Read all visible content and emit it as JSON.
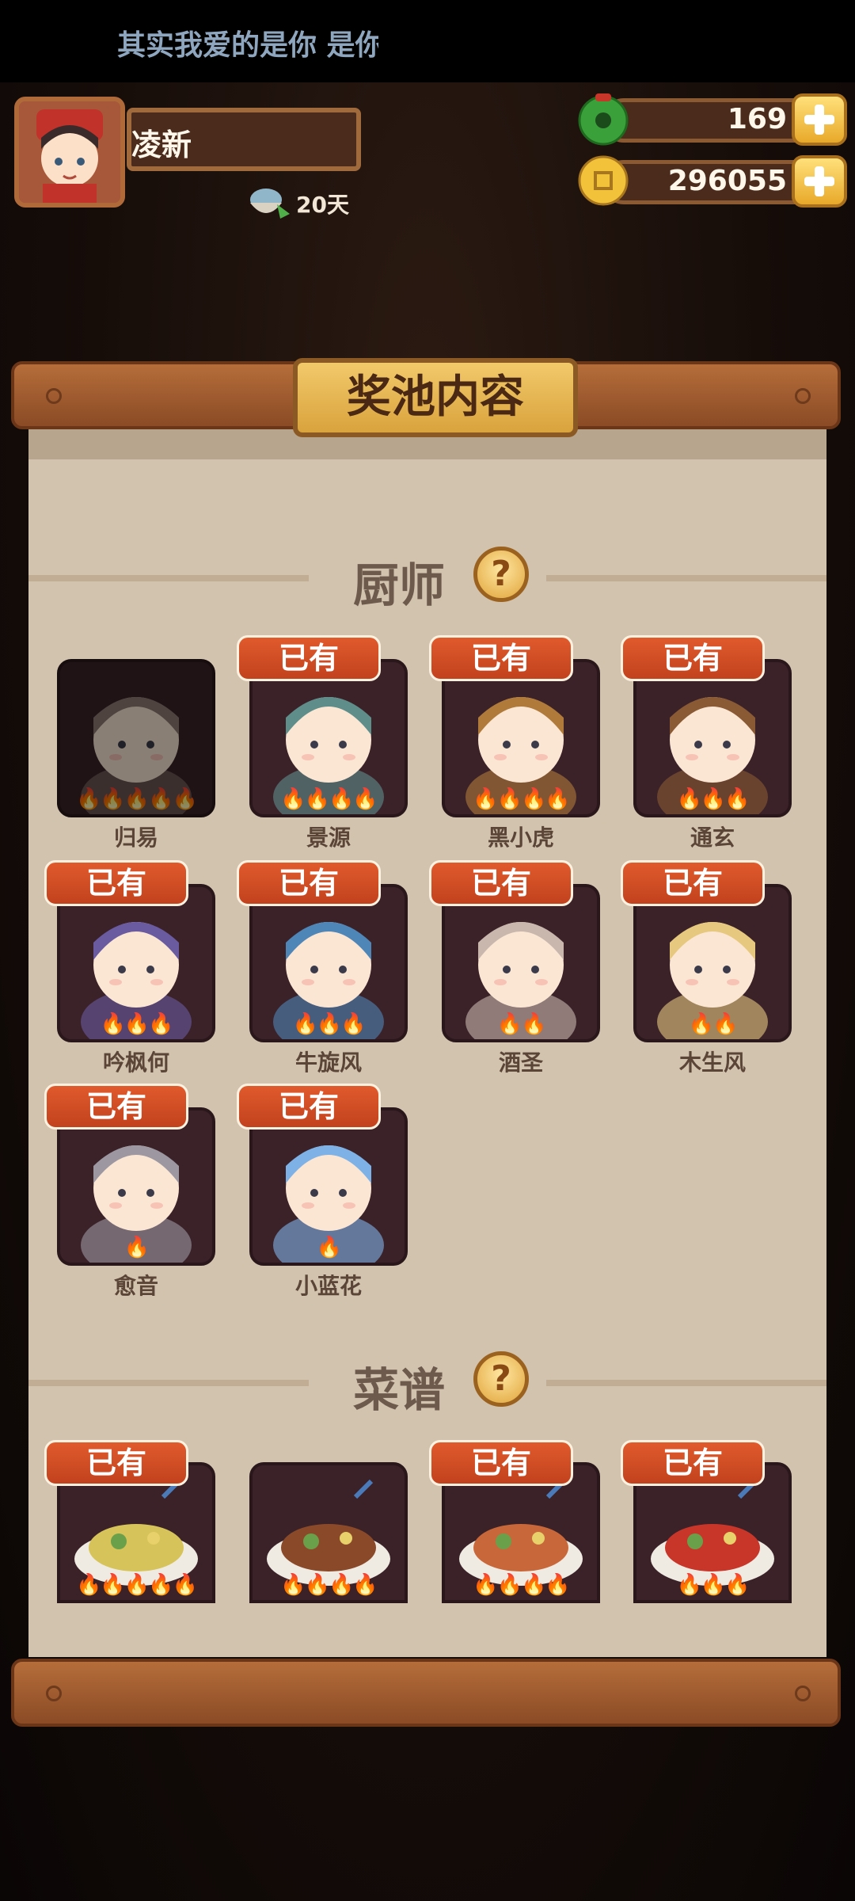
{
  "status_bar": {
    "lyric": "其实我爱的是你 是你"
  },
  "player": {
    "name": "凌新",
    "days": "20天"
  },
  "currency": {
    "jade": "169",
    "coins": "296055"
  },
  "panel": {
    "title": "奖池内容"
  },
  "chefs": {
    "title": "厨师",
    "help": "?",
    "owned_label": "已有",
    "items": [
      {
        "name": "归易",
        "owned": false,
        "stars": 5,
        "color": "#8d7a72"
      },
      {
        "name": "景源",
        "owned": true,
        "stars": 4,
        "color": "#5f8e8a"
      },
      {
        "name": "黑小虎",
        "owned": true,
        "stars": 4,
        "color": "#b07a3a"
      },
      {
        "name": "通玄",
        "owned": true,
        "stars": 3,
        "color": "#8a5a34"
      },
      {
        "name": "吟枫何",
        "owned": true,
        "stars": 3,
        "color": "#6a5aa0"
      },
      {
        "name": "牛旋风",
        "owned": true,
        "stars": 3,
        "color": "#4f86b8"
      },
      {
        "name": "酒圣",
        "owned": true,
        "stars": 2,
        "color": "#c9b7ad"
      },
      {
        "name": "木生风",
        "owned": true,
        "stars": 2,
        "color": "#e6c87e"
      },
      {
        "name": "愈音",
        "owned": true,
        "stars": 1,
        "color": "#9c97a0"
      },
      {
        "name": "小蓝花",
        "owned": true,
        "stars": 1,
        "color": "#7eb2e6"
      }
    ]
  },
  "recipes": {
    "title": "菜谱",
    "help": "?",
    "owned_label": "已有",
    "items": [
      {
        "owned": true,
        "stars": 5,
        "color": "#d6c45a"
      },
      {
        "owned": false,
        "stars": 4,
        "color": "#8a4a2a"
      },
      {
        "owned": true,
        "stars": 4,
        "color": "#c8683a"
      },
      {
        "owned": true,
        "stars": 3,
        "color": "#c8362a"
      }
    ]
  }
}
